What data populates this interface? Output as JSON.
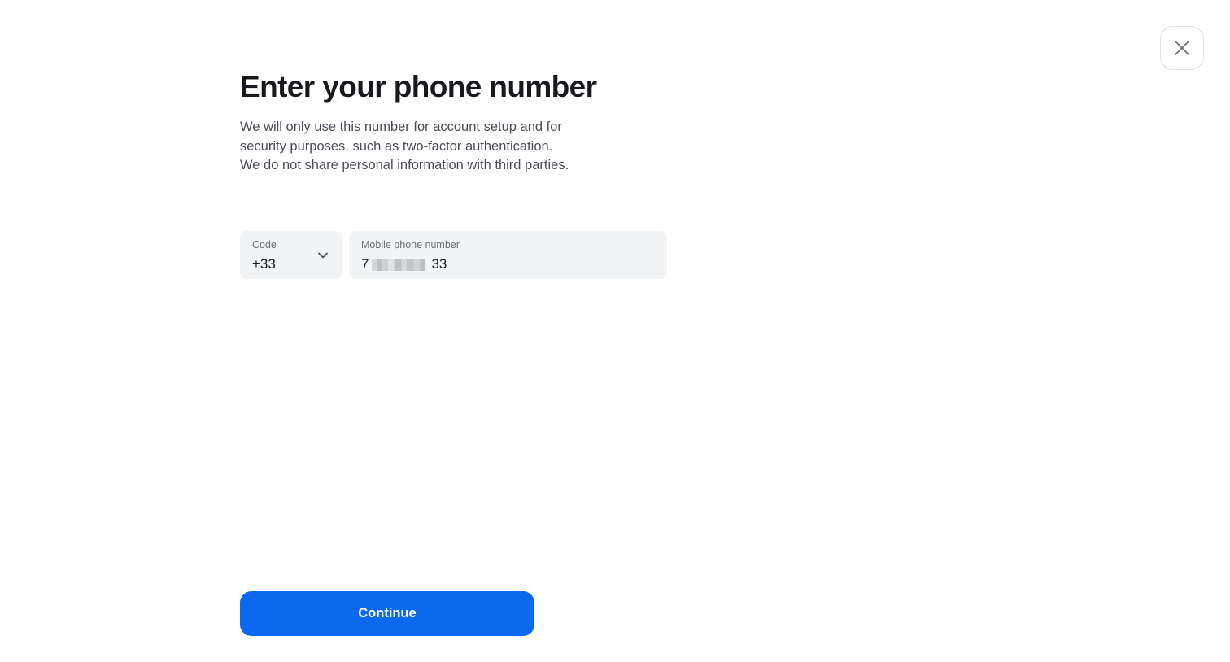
{
  "close": {
    "icon": "close-icon"
  },
  "header": {
    "title": "Enter your phone number",
    "description_lines": [
      "We will only use this number for account setup and for",
      "security purposes, such as two-factor authentication.",
      "We do not share personal information with third parties."
    ]
  },
  "form": {
    "code": {
      "label": "Code",
      "value": "+33",
      "icon": "chevron-down-icon"
    },
    "phone": {
      "label": "Mobile phone number",
      "value_start": "7",
      "value_end": "33"
    }
  },
  "actions": {
    "continue_label": "Continue"
  },
  "colors": {
    "primary": "#0c68ef",
    "field_background": "#f3f4f6",
    "title_text": "#18191c",
    "body_text": "#4a4d55",
    "label_text": "#6b6f78"
  }
}
